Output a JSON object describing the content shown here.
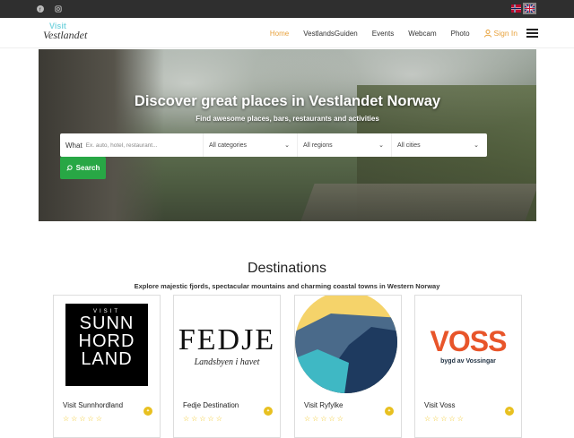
{
  "topbar": {
    "social": [
      {
        "icon": "facebook-icon",
        "glyph": "f"
      },
      {
        "icon": "instagram-icon",
        "glyph": "◎"
      }
    ],
    "languages": [
      {
        "code": "no",
        "icon": "norway-flag-icon"
      },
      {
        "code": "en",
        "icon": "uk-flag-icon",
        "active": true
      }
    ]
  },
  "header": {
    "logo_small": "Visit",
    "logo_big": "Vestlandet",
    "menu": [
      {
        "label": "Home",
        "active": true
      },
      {
        "label": "VestlandsGuiden"
      },
      {
        "label": "Events"
      },
      {
        "label": "Webcam"
      },
      {
        "label": "Photo"
      }
    ],
    "signin_label": "Sign In"
  },
  "hero": {
    "title": "Discover great places in Vestlandet Norway",
    "subtitle": "Find awesome places, bars, restaurants and activities",
    "search": {
      "what_label": "What",
      "what_placeholder": "Ex. auto, hotel, restaurant...",
      "categories": "All categories",
      "regions": "All regions",
      "cities": "All cities",
      "button_label": "Search"
    }
  },
  "destinations": {
    "title": "Destinations",
    "subtitle": "Explore majestic fjords, spectacular mountains and charming coastal towns in Western Norway",
    "cards": [
      {
        "name": "Visit Sunnhordland",
        "stars": "☆☆☆☆☆",
        "logo_top": "VISIT",
        "logo_lines": [
          "SUNN",
          "HORD",
          "LAND"
        ]
      },
      {
        "name": "Fedje Destination",
        "stars": "☆☆☆☆☆",
        "logo_word": "FEDJE",
        "logo_tagline": "Landsbyen i havet"
      },
      {
        "name": "Visit Ryfylke",
        "stars": "☆☆☆☆☆"
      },
      {
        "name": "Visit Voss",
        "stars": "☆☆☆☆☆",
        "logo_word": "VOSS",
        "logo_tagline": "bygd av Vossingar"
      }
    ]
  },
  "colors": {
    "accent": "#e8a23c",
    "search_button": "#28a745",
    "topbar": "#2f2f2f",
    "star": "#f0c419"
  }
}
